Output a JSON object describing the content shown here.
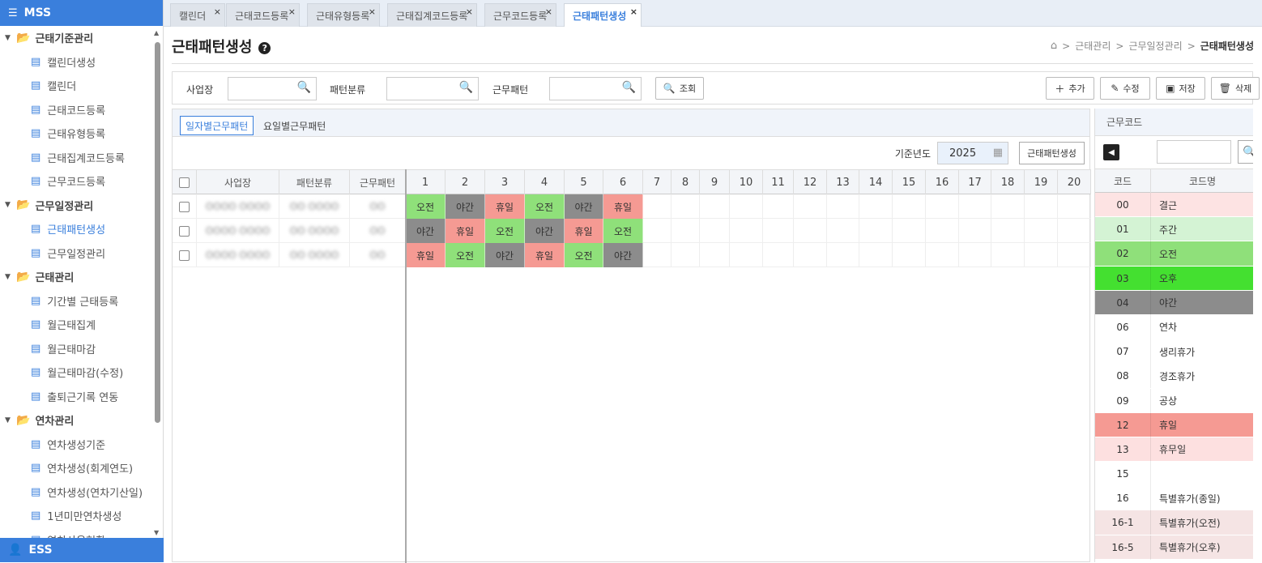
{
  "sidebar": {
    "header": "MSS",
    "footer": "ESS",
    "groups": [
      {
        "label": "근태기준관리",
        "items": [
          "캘린더생성",
          "캘린더",
          "근태코드등록",
          "근태유형등록",
          "근태집계코드등록",
          "근무코드등록"
        ]
      },
      {
        "label": "근무일정관리",
        "items": [
          "근태패턴생성",
          "근무일정관리"
        ]
      },
      {
        "label": "근태관리",
        "items": [
          "기간별 근태등록",
          "월근태집계",
          "월근태마감",
          "월근태마감(수정)",
          "출퇴근기록 연동"
        ]
      },
      {
        "label": "연차관리",
        "items": [
          "연차생성기준",
          "연차생성(회계연도)",
          "연차생성(연차기산일)",
          "1년미만연차생성",
          "연차사용현황"
        ]
      }
    ],
    "active_item": "근태패턴생성"
  },
  "tabs": [
    {
      "label": "캘린더",
      "active": false
    },
    {
      "label": "근태코드등록",
      "active": false
    },
    {
      "label": "근태유형등록",
      "active": false
    },
    {
      "label": "근태집계코드등록",
      "active": false
    },
    {
      "label": "근무코드등록",
      "active": false
    },
    {
      "label": "근태패턴생성",
      "active": true
    }
  ],
  "page_title": "근태패턴생성",
  "breadcrumb": {
    "items": [
      "근태관리",
      "근무일정관리"
    ],
    "current": "근태패턴생성",
    "sep": ">"
  },
  "search": {
    "field1_label": "사업장",
    "field2_label": "패턴분류",
    "field3_label": "근무패턴",
    "search_label": "조회",
    "add_label": "추가",
    "edit_label": "수정",
    "save_label": "저장",
    "delete_label": "삭제"
  },
  "subtabs": [
    "일자별근무패턴",
    "요일별근무패턴"
  ],
  "year": {
    "label": "기준년도",
    "value": "2025",
    "generate_label": "근태패턴생성"
  },
  "grid": {
    "headers": [
      "사업장",
      "패턴분류",
      "근무패턴"
    ],
    "days": [
      "1",
      "2",
      "3",
      "4",
      "5",
      "6",
      "7",
      "8",
      "9",
      "10",
      "11",
      "12",
      "13",
      "14",
      "15",
      "16",
      "17",
      "18",
      "19",
      "20"
    ],
    "rows": [
      {
        "site": "OOOO OOOO",
        "class": "OO OOOO",
        "pattern": "OO",
        "shifts": [
          "오전",
          "야간",
          "휴일",
          "오전",
          "야간",
          "휴일"
        ]
      },
      {
        "site": "OOOO OOOO",
        "class": "OO OOOO",
        "pattern": "OO",
        "shifts": [
          "야간",
          "휴일",
          "오전",
          "야간",
          "휴일",
          "오전"
        ]
      },
      {
        "site": "OOOO OOOO",
        "class": "OO OOOO",
        "pattern": "OO",
        "shifts": [
          "휴일",
          "오전",
          "야간",
          "휴일",
          "오전",
          "야간"
        ]
      }
    ]
  },
  "shift_colors": {
    "오전": "#8fe07a",
    "야간": "#8c8c8c",
    "휴일": "#f59a93"
  },
  "codes": {
    "title": "근무코드",
    "col_code": "코드",
    "col_name": "코드명",
    "rows": [
      {
        "code": "00",
        "name": "결근",
        "color": "#fde3e3"
      },
      {
        "code": "01",
        "name": "주간",
        "color": "#d4f3d4"
      },
      {
        "code": "02",
        "name": "오전",
        "color": "#8fe07a"
      },
      {
        "code": "03",
        "name": "오후",
        "color": "#44e030"
      },
      {
        "code": "04",
        "name": "야간",
        "color": "#8c8c8c"
      },
      {
        "code": "06",
        "name": "연차",
        "color": "#ffffff"
      },
      {
        "code": "07",
        "name": "생리휴가",
        "color": "#ffffff"
      },
      {
        "code": "08",
        "name": "경조휴가",
        "color": "#ffffff"
      },
      {
        "code": "09",
        "name": "공상",
        "color": "#ffffff"
      },
      {
        "code": "12",
        "name": "휴일",
        "color": "#f59a93"
      },
      {
        "code": "13",
        "name": "휴무일",
        "color": "#fde0e0"
      },
      {
        "code": "15",
        "name": "",
        "color": "#ffffff"
      },
      {
        "code": "16",
        "name": "특별휴가(종일)",
        "color": "#ffffff"
      },
      {
        "code": "16-1",
        "name": "특별휴가(오전)",
        "color": "#f5e4e4"
      },
      {
        "code": "16-5",
        "name": "특별휴가(오후)",
        "color": "#f5e4e4"
      }
    ]
  }
}
